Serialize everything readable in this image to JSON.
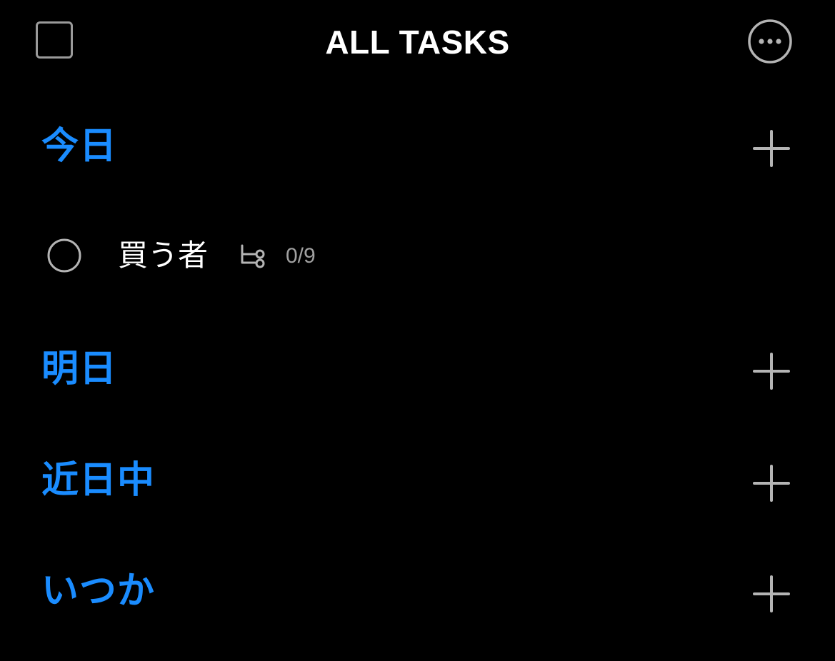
{
  "header": {
    "title": "ALL TASKS",
    "select_icon": "square-outline-icon",
    "more_icon": "ellipsis-circle-icon"
  },
  "sections": [
    {
      "title": "今日",
      "add_icon": "plus-icon",
      "tasks": [
        {
          "title": "買う者",
          "checkbox_icon": "circle-outline-icon",
          "subtask_icon": "subtask-icon",
          "subtask_count": "0/9"
        }
      ]
    },
    {
      "title": "明日",
      "add_icon": "plus-icon",
      "tasks": []
    },
    {
      "title": "近日中",
      "add_icon": "plus-icon",
      "tasks": []
    },
    {
      "title": "いつか",
      "add_icon": "plus-icon",
      "tasks": []
    }
  ],
  "colors": {
    "background": "#000000",
    "accent": "#1a8cff",
    "primary_text": "#ffffff",
    "secondary_text": "#a0a0a0",
    "icon_gray": "#b4b4b4"
  }
}
